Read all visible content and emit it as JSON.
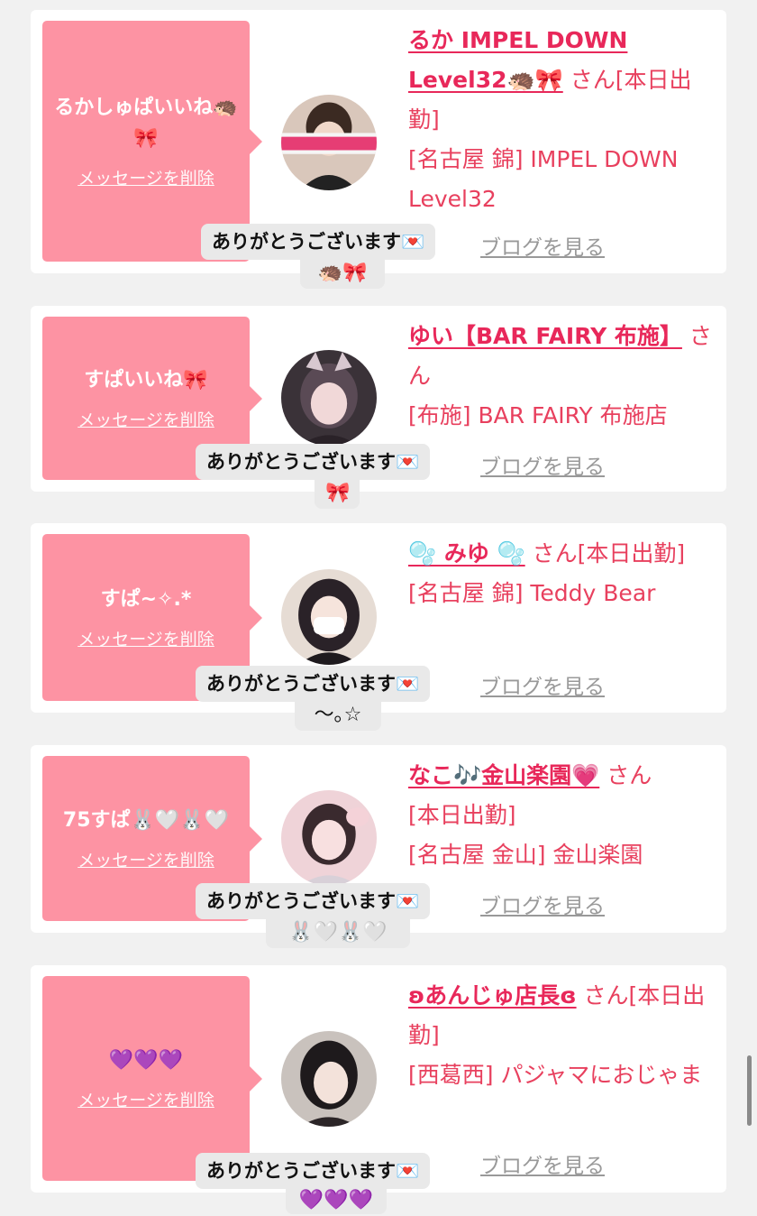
{
  "cards": [
    {
      "message": "るかしゅぱいいね🦔🎀",
      "delete_label": "メッセージを削除",
      "name": "るか IMPEL DOWN Level32🦔🎀",
      "suffix": "さん",
      "status": "[本日出勤]",
      "shop": "[名古屋 錦] IMPEL DOWN Level32",
      "blog_label": "ブログを見る",
      "reply_line1": "ありがとうございます💌",
      "reply_line2": "🦔🎀"
    },
    {
      "message": "すぱいいね🎀",
      "delete_label": "メッセージを削除",
      "name": "ゆい【BAR FAIRY 布施】",
      "suffix": "さん",
      "status": "",
      "shop": "[布施] BAR FAIRY 布施店",
      "blog_label": "ブログを見る",
      "reply_line1": "ありがとうございます💌",
      "reply_line2": "🎀"
    },
    {
      "message": "すぱ~✧.*",
      "delete_label": "メッセージを削除",
      "name": "🫧 みゆ 🫧",
      "suffix": "さん",
      "status": "[本日出勤]",
      "shop": "[名古屋 錦] Teddy Bear",
      "blog_label": "ブログを見る",
      "reply_line1": "ありがとうございます💌",
      "reply_line2": "〜｡☆"
    },
    {
      "message": "75すぱ🐰🤍🐰🤍",
      "delete_label": "メッセージを削除",
      "name": "なこ🎶金山楽園💗",
      "suffix": "さん",
      "status": "[本日出勤]",
      "shop": "[名古屋 金山] 金山楽園",
      "blog_label": "ブログを見る",
      "reply_line1": "ありがとうございます💌",
      "reply_line2": "🐰🤍🐰🤍"
    },
    {
      "message": "💜💜💜",
      "delete_label": "メッセージを削除",
      "name": "ʚあんじゅ店長ɞ",
      "suffix": "さん",
      "status": "[本日出勤]",
      "shop": "[西葛西] パジャマにおじゃま",
      "blog_label": "ブログを見る",
      "reply_line1": "ありがとうございます💌",
      "reply_line2": "💜💜💜"
    }
  ],
  "colors": {
    "accent": "#e8285a",
    "bubble": "#fd93a3",
    "background": "#f1f1f1"
  }
}
